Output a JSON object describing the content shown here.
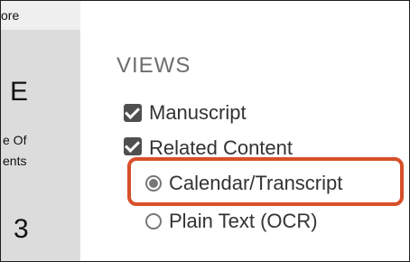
{
  "sidebar": {
    "more_label": "ore",
    "glyph_top": "E",
    "line1": "e Of",
    "line2": "ents",
    "glyph_bottom": "3"
  },
  "views": {
    "title": "VIEWS",
    "checkboxes": [
      {
        "label": "Manuscript",
        "checked": true
      },
      {
        "label": "Related Content",
        "checked": true
      }
    ],
    "radios": [
      {
        "label": "Calendar/Transcript",
        "selected": true
      },
      {
        "label": "Plain Text (OCR)",
        "selected": false
      }
    ]
  },
  "colors": {
    "highlight": "#d7502a",
    "sidebar_bg": "#dcdcdc",
    "checkbox": "#4f4f4f"
  }
}
